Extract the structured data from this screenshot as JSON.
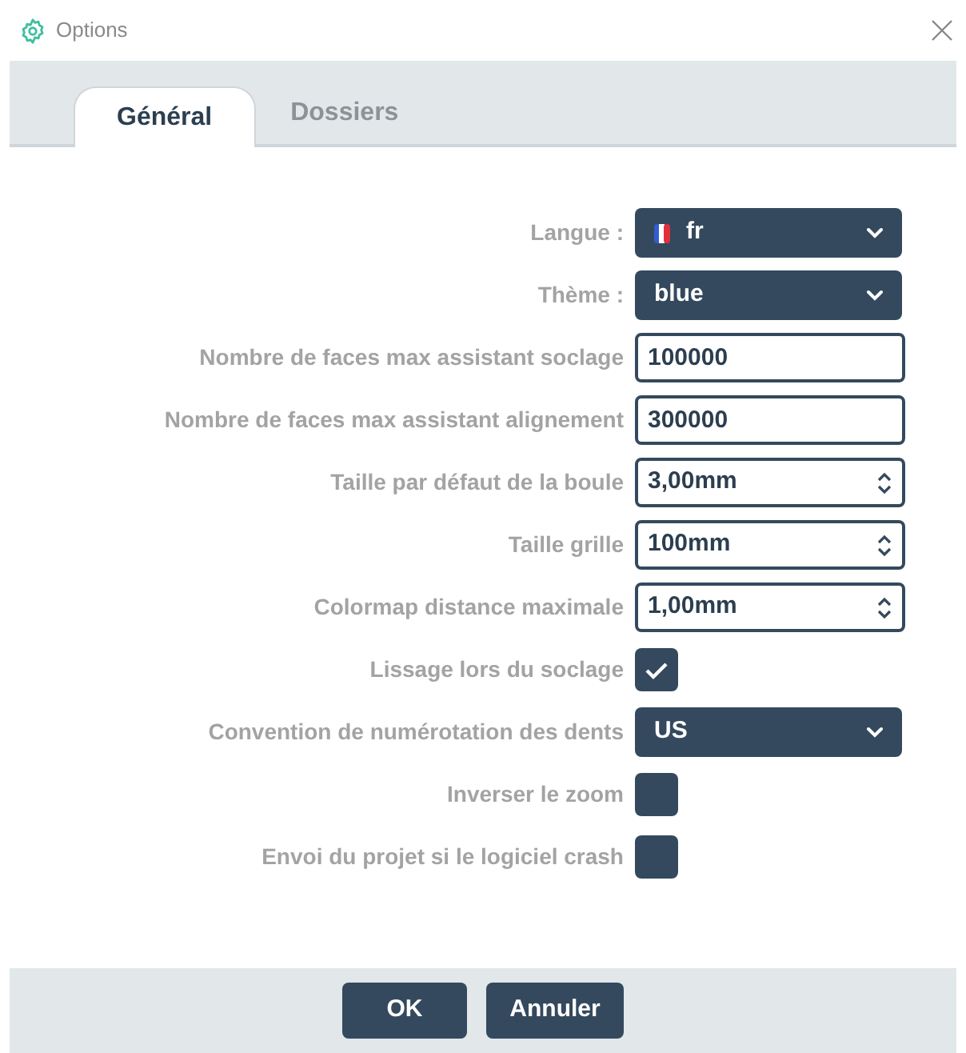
{
  "window": {
    "title": "Options"
  },
  "tabs": [
    {
      "label": "Général",
      "selected": true
    },
    {
      "label": "Dossiers",
      "selected": false
    }
  ],
  "fields": [
    {
      "kind": "select",
      "label": "Langue :",
      "value": "fr",
      "flag": true
    },
    {
      "kind": "select",
      "label": "Thème :",
      "value": "blue",
      "flag": false
    },
    {
      "kind": "text",
      "label": "Nombre de faces max assistant soclage",
      "value": "100000"
    },
    {
      "kind": "text",
      "label": "Nombre de faces max assistant alignement",
      "value": "300000"
    },
    {
      "kind": "spin",
      "label": "Taille par défaut de la boule",
      "value": "3,00mm"
    },
    {
      "kind": "spin",
      "label": "Taille grille",
      "value": "100mm"
    },
    {
      "kind": "spin",
      "label": "Colormap distance maximale",
      "value": "1,00mm"
    },
    {
      "kind": "checkbox",
      "label": "Lissage lors du soclage",
      "checked": true
    },
    {
      "kind": "select",
      "label": "Convention de numérotation des dents",
      "value": "US",
      "flag": false
    },
    {
      "kind": "checkbox",
      "label": "Inverser le zoom",
      "checked": false
    },
    {
      "kind": "checkbox",
      "label": "Envoi du projet si le logiciel crash",
      "checked": false
    }
  ],
  "buttons": [
    "OK",
    "Annuler"
  ]
}
